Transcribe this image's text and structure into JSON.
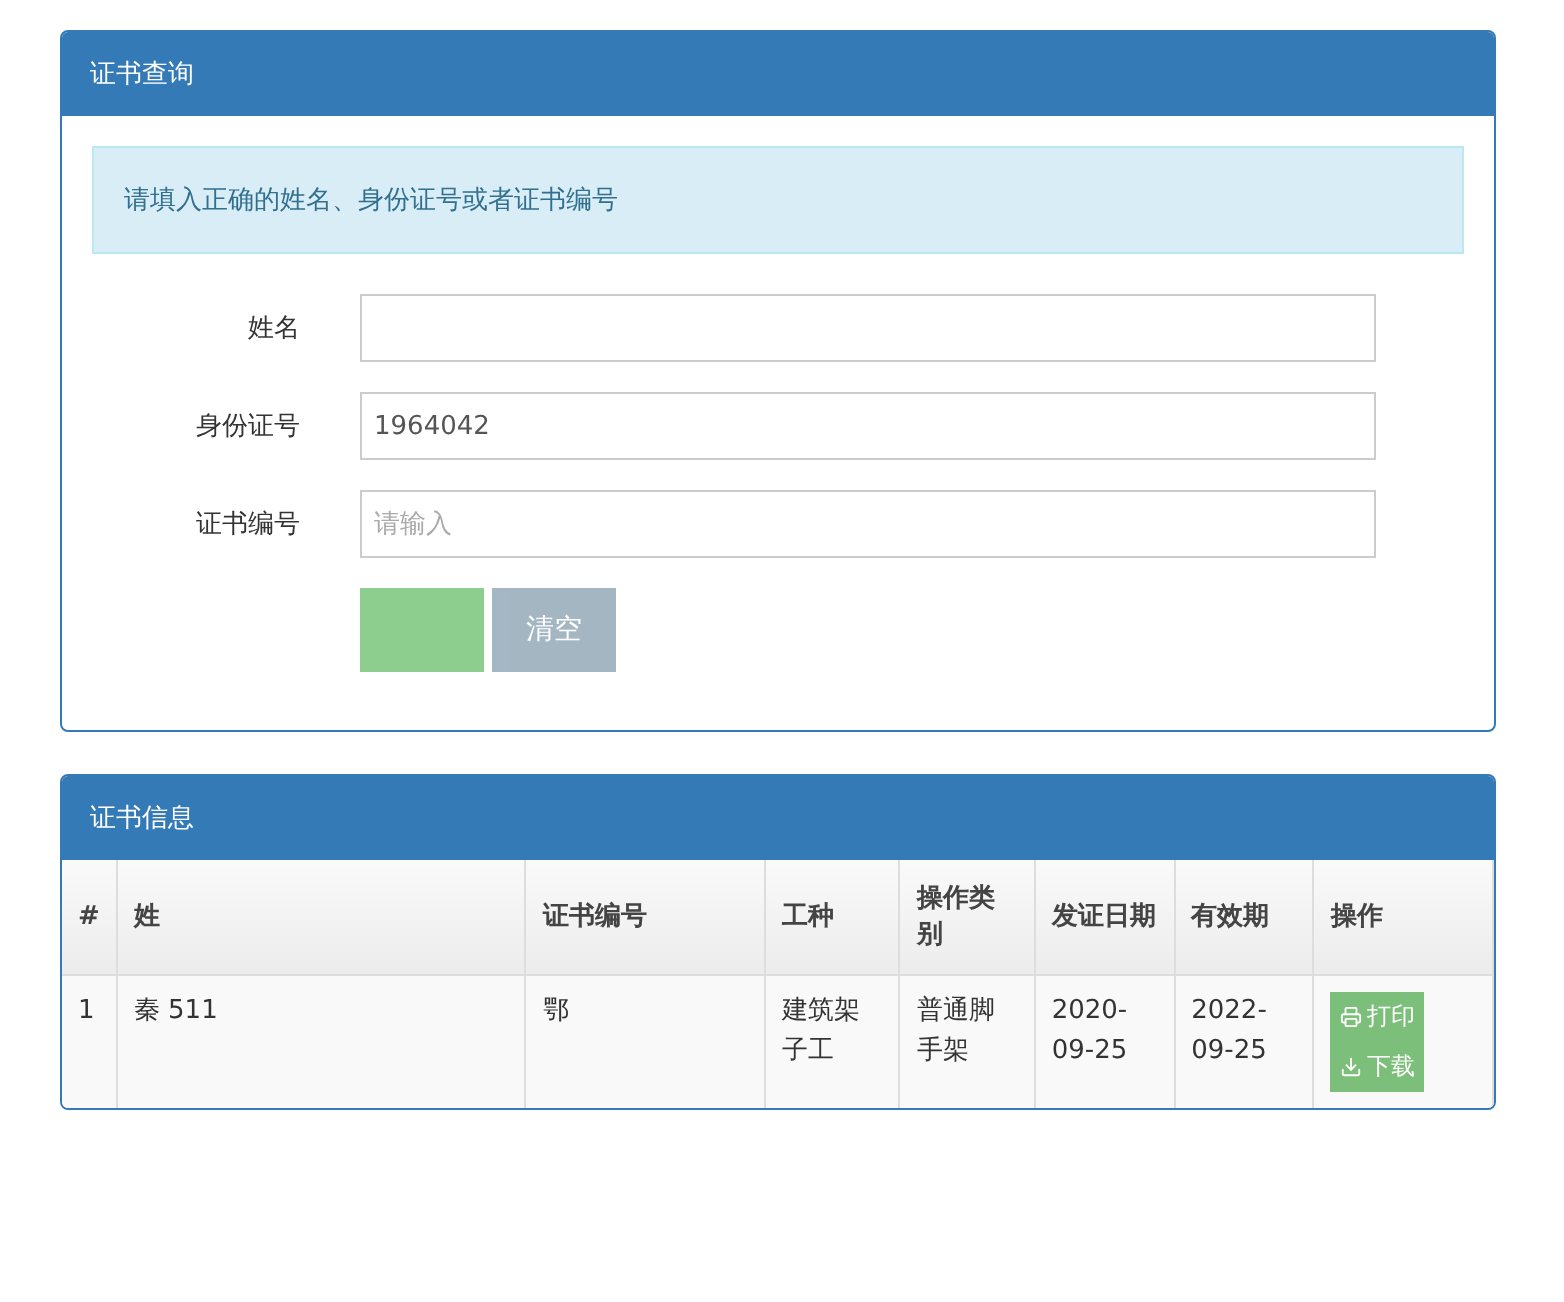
{
  "query_panel": {
    "title": "证书查询",
    "alert": "请填入正确的姓名、身份证号或者证书编号",
    "fields": [
      {
        "label": "姓名"
      },
      {
        "label": "身份证号",
        "value": "1964042"
      },
      {
        "label": "证书编号",
        "placeholder": "请输入"
      }
    ],
    "buttons": [
      {
        "kind": "primary",
        "disabled": true
      },
      {
        "kind": "secondary",
        "label": "清空",
        "disabled": true
      }
    ]
  },
  "info_panel": {
    "title": "证书信息",
    "table": {
      "columns": [
        "#",
        "姓",
        "证书编号",
        "工种",
        "操作类别",
        "发证日期",
        "有效期",
        "操作"
      ],
      "rows": [
        {
          "cells": [
            "1",
            "秦 511",
            "鄂",
            "建筑架子工",
            "普通脚手架",
            "2020-09-25",
            "2022-09-25"
          ],
          "actions": [
            {
              "kind": "print",
              "label": "打印"
            },
            {
              "kind": "download",
              "label": "下载"
            }
          ]
        }
      ]
    }
  }
}
